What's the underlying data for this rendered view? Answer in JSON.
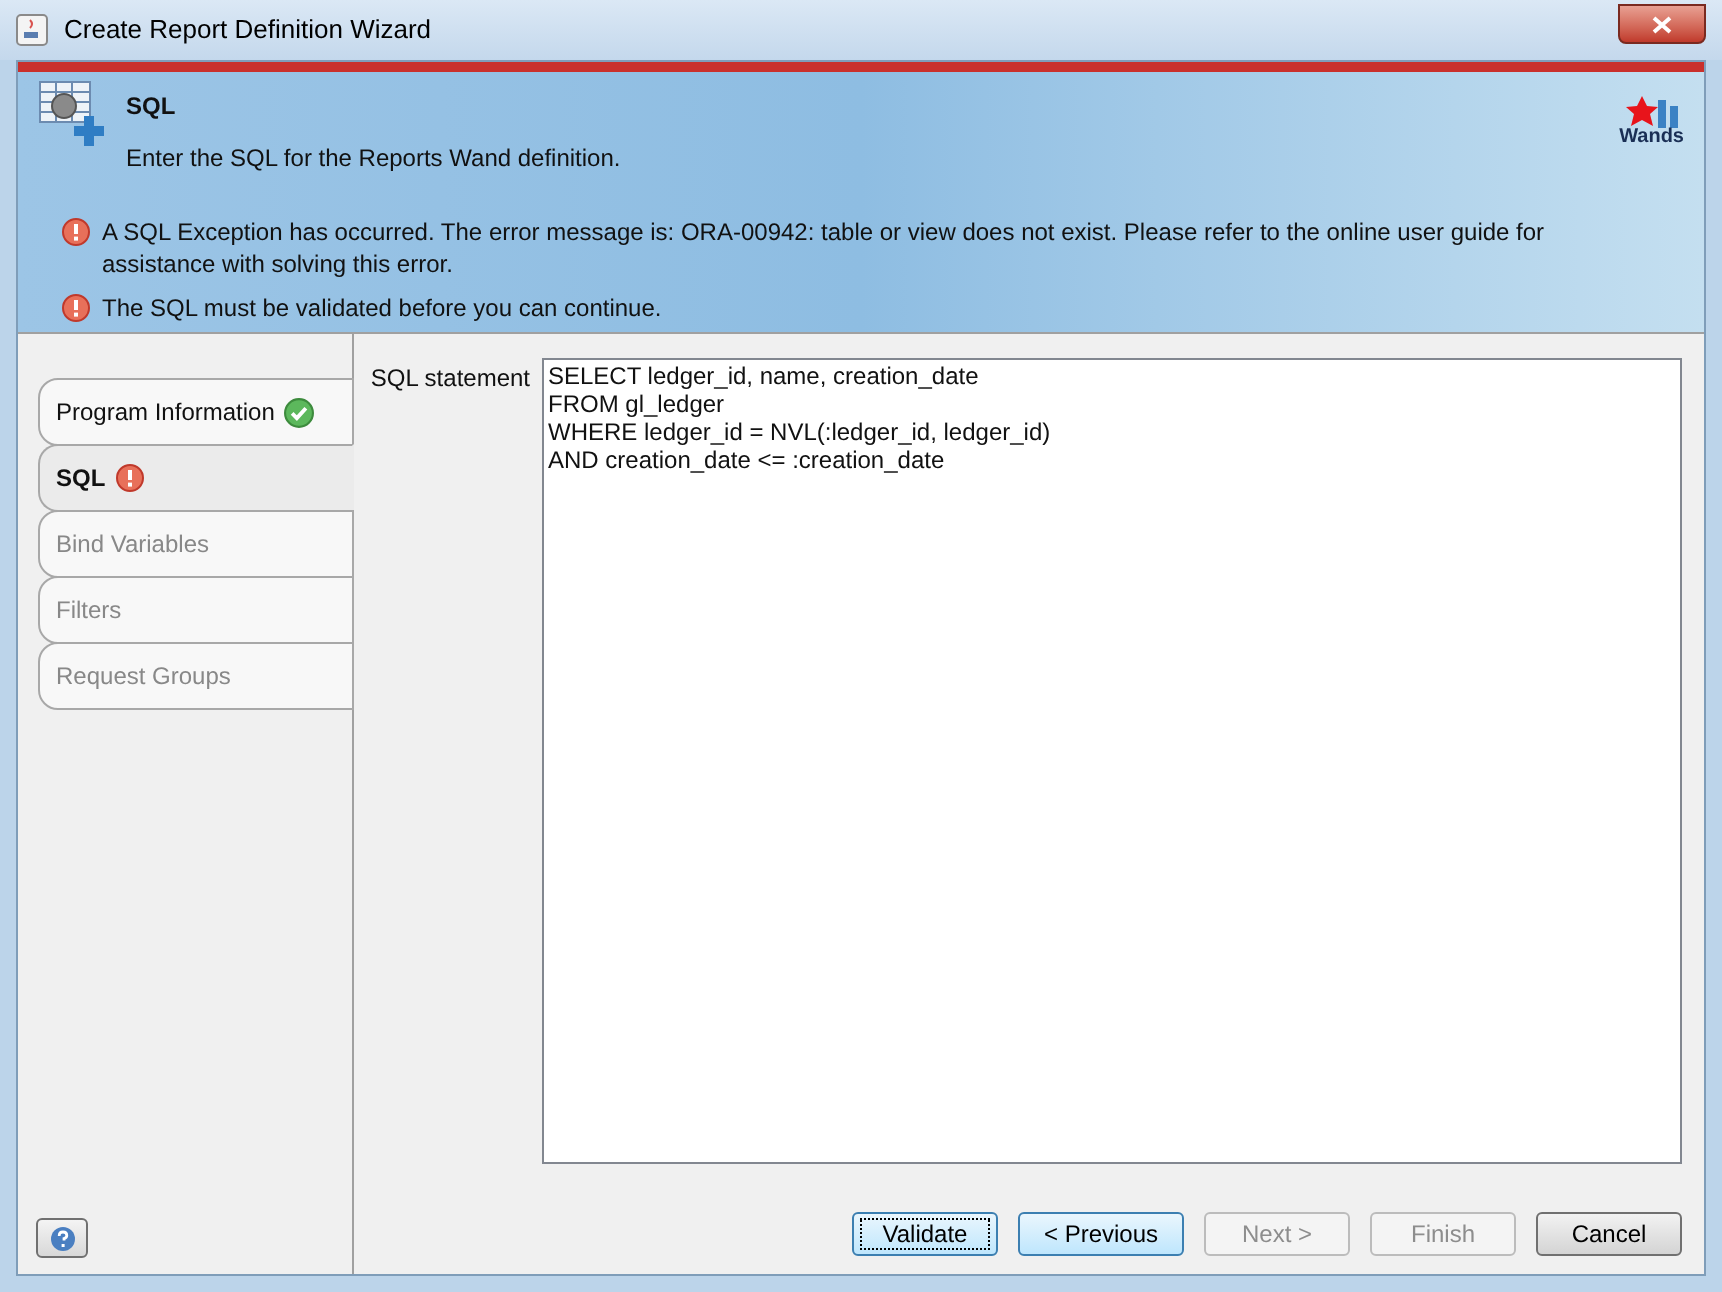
{
  "window": {
    "title": "Create Report Definition Wizard"
  },
  "header": {
    "title": "SQL",
    "subtitle": "Enter the SQL for the Reports Wand definition.",
    "logo_text": "Wands"
  },
  "messages": [
    {
      "text": "A SQL Exception has occurred. The error message is: ORA-00942: table or view does not exist. Please refer to the online user guide for assistance with solving this error."
    },
    {
      "text": "The SQL must be validated before you can continue."
    }
  ],
  "steps": [
    {
      "label": "Program Information",
      "selected": false,
      "disabled": false,
      "kind": "done"
    },
    {
      "label": "SQL",
      "selected": true,
      "disabled": false,
      "kind": "error"
    },
    {
      "label": "Bind Variables",
      "selected": false,
      "disabled": true,
      "kind": "plain"
    },
    {
      "label": "Filters",
      "selected": false,
      "disabled": true,
      "kind": "plain"
    },
    {
      "label": "Request Groups",
      "selected": false,
      "disabled": true,
      "kind": "plain"
    }
  ],
  "sql": {
    "label": "SQL statement",
    "value": "SELECT ledger_id, name, creation_date\nFROM gl_ledger\nWHERE ledger_id = NVL(:ledger_id, ledger_id)\nAND creation_date <= :creation_date"
  },
  "buttons": [
    {
      "label": "Validate",
      "disabled": false,
      "focused": true,
      "highlighted": false
    },
    {
      "label": "< Previous",
      "disabled": false,
      "focused": false,
      "highlighted": true
    },
    {
      "label": "Next >",
      "disabled": true,
      "focused": false,
      "highlighted": false
    },
    {
      "label": "Finish",
      "disabled": true,
      "focused": false,
      "highlighted": false
    },
    {
      "label": "Cancel",
      "disabled": false,
      "focused": false,
      "highlighted": false
    }
  ]
}
